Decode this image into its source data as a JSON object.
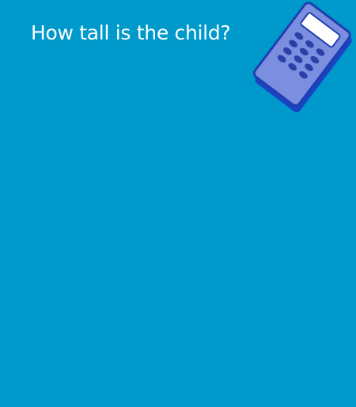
{
  "question": {
    "text": "How tall is the child?"
  },
  "colors": {
    "background": "#0099cc",
    "text": "#ffffff",
    "calculator_body": "#7b8ee0",
    "calculator_shadow": "#1a44c4",
    "calculator_outline": "#1f3fb0",
    "calculator_screen": "#ffffff",
    "calculator_keys": "#2a3fa8"
  },
  "icons": {
    "calculator": "calculator-icon"
  }
}
